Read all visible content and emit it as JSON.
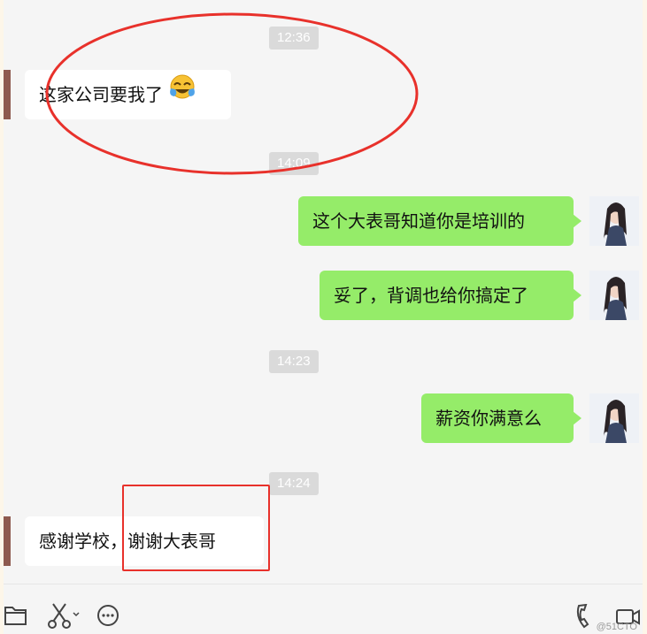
{
  "chat": {
    "timestamps": [
      "12:36",
      "14:09",
      "14:23",
      "14:24"
    ],
    "messages": [
      {
        "side": "in",
        "text": "这家公司要我了",
        "emoji": "tears-of-joy-emoji"
      },
      {
        "side": "out",
        "text": "这个大表哥知道你是培训的"
      },
      {
        "side": "out",
        "text": "妥了，背调也给你搞定了"
      },
      {
        "side": "out",
        "text": "薪资你满意么"
      },
      {
        "side": "in",
        "text": "感谢学校，谢谢大表哥"
      }
    ]
  },
  "toolbar": {
    "icons": [
      "folder-icon",
      "scissors-icon",
      "chat-bubble-icon",
      "phone-icon",
      "video-call-icon"
    ]
  },
  "watermark": "@51CTO",
  "colors": {
    "incoming_bubble": "#ffffff",
    "outgoing_bubble": "#95ec69",
    "background": "#f5f5f5",
    "annotation": "#e8312b"
  }
}
